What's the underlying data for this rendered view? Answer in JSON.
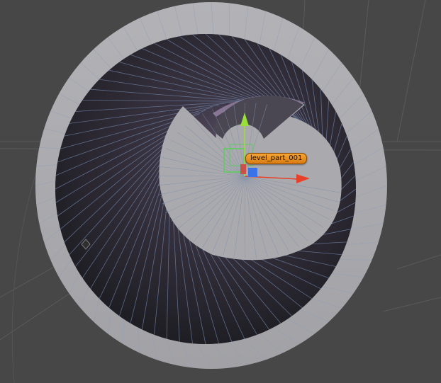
{
  "viewport": {
    "background_color": "#474747",
    "grid_color": "#595959"
  },
  "selected_object": {
    "name": "level_part_001"
  },
  "mesh": {
    "outer_ring_color": "#a8a8ac",
    "inner_core_color": "#a9a9ad",
    "tunnel_color": "#2a2830",
    "wire_color": "#6f84a8"
  },
  "gizmo": {
    "x_axis_color": "#e8412a",
    "y_axis_color": "#9ae03a",
    "z_axis_color": "#3a73e8",
    "selection_box_color": "#58d058"
  },
  "icons": {
    "light_icon": "diamond"
  }
}
